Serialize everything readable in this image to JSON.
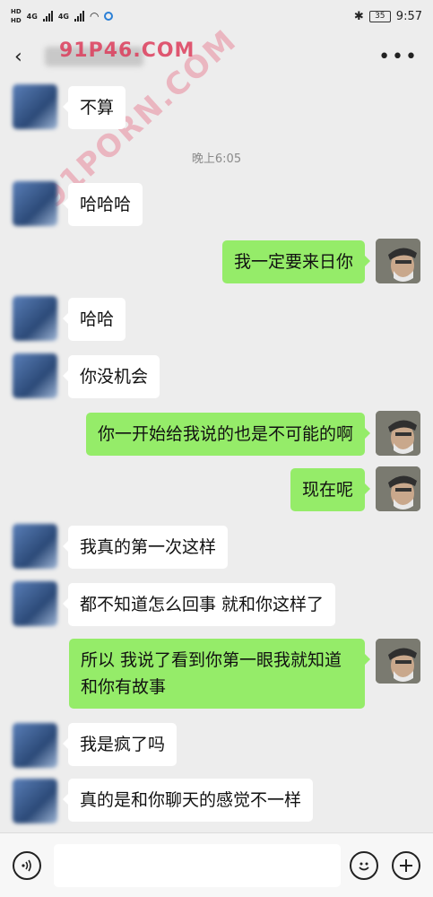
{
  "status_bar": {
    "network_labels": [
      "HD",
      "HD"
    ],
    "signal_labels": [
      "4G",
      "4G"
    ],
    "battery": "35",
    "time": "9:57"
  },
  "nav": {
    "back_icon": "chevron-left-icon",
    "more_icon": "more-dots-icon",
    "more_label": "•••"
  },
  "time_separator": "晚上6:05",
  "messages": [
    {
      "side": "left",
      "text": "不算"
    },
    {
      "side": "left",
      "text": "哈哈哈"
    },
    {
      "side": "right",
      "text": "我一定要来日你"
    },
    {
      "side": "left",
      "text": "哈哈"
    },
    {
      "side": "left",
      "text": "你没机会"
    },
    {
      "side": "right",
      "text": "你一开始给我说的也是不可能的啊"
    },
    {
      "side": "right",
      "text": "现在呢"
    },
    {
      "side": "left",
      "text": "我真的第一次这样"
    },
    {
      "side": "left",
      "text": "都不知道怎么回事 就和你这样了"
    },
    {
      "side": "right",
      "text": "所以 我说了看到你第一眼我就知道\n和你有故事"
    },
    {
      "side": "left",
      "text": "我是疯了吗"
    },
    {
      "side": "left",
      "text": "真的是和你聊天的感觉不一样"
    }
  ],
  "watermarks": [
    "91P46.COM",
    "91PORN.COM"
  ],
  "input_bar": {
    "voice_icon": "voice-icon",
    "emoji_icon": "emoji-icon",
    "add_icon": "plus-icon",
    "input_value": ""
  },
  "colors": {
    "background": "#ededed",
    "sent_bubble": "#95ec69",
    "received_bubble": "#ffffff"
  }
}
